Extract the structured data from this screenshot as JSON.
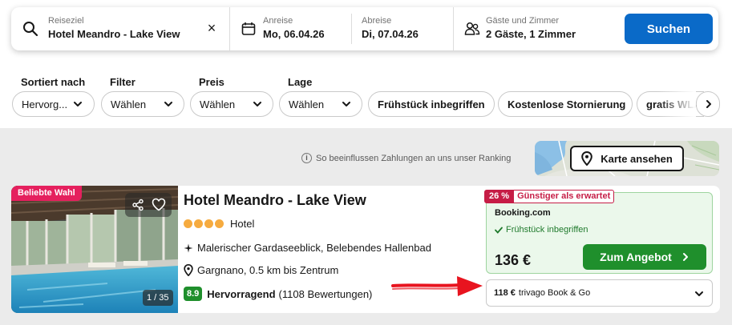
{
  "search": {
    "destination_label": "Reiseziel",
    "destination_value": "Hotel Meandro - Lake View",
    "clear_symbol": "×",
    "checkin_label": "Anreise",
    "checkin_value": "Mo, 06.04.26",
    "checkout_label": "Abreise",
    "checkout_value": "Di, 07.04.26",
    "guests_label": "Gäste und Zimmer",
    "guests_value": "2 Gäste, 1 Zimmer",
    "button_label": "Suchen",
    "accent_color": "#0a6ac8"
  },
  "filters": {
    "groups": [
      {
        "label": "Sortiert nach",
        "value": "Hervorg..."
      },
      {
        "label": "Filter",
        "value": "Wählen"
      },
      {
        "label": "Preis",
        "value": "Wählen"
      },
      {
        "label": "Lage",
        "value": "Wählen"
      }
    ],
    "quick": [
      "Frühstück inbegriffen",
      "Kostenlose Stornierung",
      "gratis WLAN"
    ]
  },
  "results": {
    "ranking_note": "So beeinflussen Zahlungen an uns unser Ranking",
    "map_button": "Karte ansehen",
    "hotel": {
      "badge": "Beliebte Wahl",
      "photo_counter": "1 / 35",
      "name": "Hotel Meandro - Lake View",
      "stars": 4,
      "type": "Hotel",
      "highlight": "Malerischer Gardaseeblick, Belebendes Hallenbad",
      "location": "Gargnano, 0.5 km bis Zentrum",
      "rating_score": "8.9",
      "rating_label": "Hervorragend",
      "rating_count": "(1108 Bewertungen)",
      "deal": {
        "discount": "26 %",
        "discount_text": "Günstiger als erwartet",
        "provider": "Booking.com",
        "benefit": "Frühstück inbegriffen",
        "price": "136 €",
        "button": "Zum Angebot"
      },
      "alt_offer": {
        "price": "118 €",
        "provider": "trivago Book & Go"
      }
    }
  },
  "colors": {
    "deal_green": "#1f8f2c",
    "badge_pink": "#e5205e",
    "discount_red": "#c61d46",
    "star_orange": "#f6ab3f",
    "annotation_arrow": "#e8141f"
  }
}
